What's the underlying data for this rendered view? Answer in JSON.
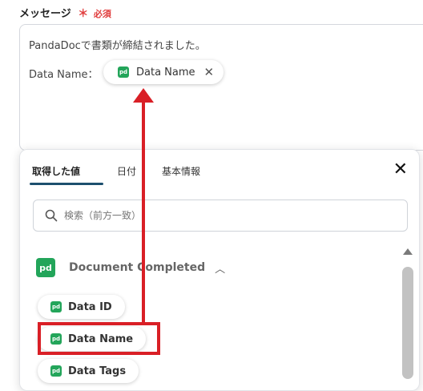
{
  "field": {
    "label": "メッセージ",
    "required_mark": "＊",
    "required_text": "必須"
  },
  "message": {
    "line1": "PandaDocで書類が締結されました。",
    "line2_label": "Data Name：",
    "chip_label": "Data Name",
    "chip_badge": "pd"
  },
  "panel": {
    "tabs": [
      {
        "label": "取得した値",
        "active": true
      },
      {
        "label": "日付",
        "active": false
      },
      {
        "label": "基本情報",
        "active": false
      }
    ],
    "close_glyph": "✕",
    "search_placeholder": "検索（前方一致）",
    "section_title": "Document Completed",
    "section_logo": "pd",
    "items": [
      {
        "label": "Data ID",
        "badge": "pd"
      },
      {
        "label": "Data Name",
        "badge": "pd"
      },
      {
        "label": "Data Tags",
        "badge": "pd"
      }
    ]
  },
  "colors": {
    "accent_red": "#d91f26",
    "pandadoc_green": "#23a55a",
    "tab_underline": "#1d4f6e"
  }
}
